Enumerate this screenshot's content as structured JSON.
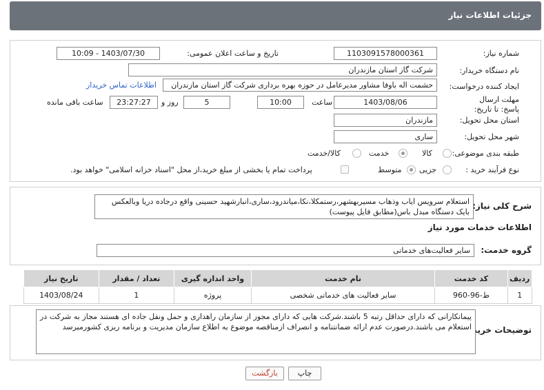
{
  "header": {
    "title": "جزئیات اطلاعات نیاز"
  },
  "form": {
    "need_number_label": "شماره نیاز:",
    "need_number": "1103091578000361",
    "announce_label": "تاریخ و ساعت اعلان عمومی:",
    "announce_value": "1403/07/30 - 10:09",
    "buyer_org_label": "نام دستگاه خریدار:",
    "buyer_org": "شرکت گاز استان مازندران",
    "creator_label": "ایجاد کننده درخواست:",
    "creator": "حشمت اله باوفا مشاور مدیرعامل در حوزه بهره برداری  شرکت گاز استان مازندران",
    "contact_link": "اطلاعات تماس خریدار",
    "deadline_label": "مهلت ارسال پاسخ: تا تاریخ:",
    "deadline_date": "1403/08/06",
    "time_label": "ساعت",
    "deadline_time": "10:00",
    "days_value": "5",
    "days_label": "روز و",
    "remaining_time": "23:27:27",
    "remaining_label": "ساعت باقی مانده",
    "province_label": "استان محل تحویل:",
    "province": "مازندران",
    "city_label": "شهر محل تحویل:",
    "city": "ساری",
    "category_label": "طبقه بندی موضوعی:",
    "category_options": [
      "کالا",
      "خدمت",
      "کالا/خدمت"
    ],
    "category_selected": "خدمت",
    "purchase_type_label": "نوع فرآیند خرید :",
    "purchase_options": [
      "جزیی",
      "متوسط"
    ],
    "purchase_selected": "متوسط",
    "payment_note": "پرداخت تمام یا بخشی از مبلغ خرید،از محل \"اسناد خزانه اسلامی\" خواهد بود."
  },
  "description": {
    "label": "شرح کلی نیاز:",
    "text": "استعلام سرویس ایاب وذهاب مسیربهشهر،رستمکلا،نکا،میاندرود،ساری،انبارشهید حسینی واقع درجاده دریا وبالعکس بایک دستگاه مبدل باس(مطابق فایل پیوست)"
  },
  "services": {
    "section_title": "اطلاعات خدمات مورد نیاز",
    "group_label": "گروه خدمت:",
    "group_value": "سایر فعالیت‌های خدماتی",
    "columns": [
      "ردیف",
      "کد خدمت",
      "نام خدمت",
      "واحد اندازه گیری",
      "تعداد / مقدار",
      "تاریخ نیاز"
    ],
    "rows": [
      {
        "row": "1",
        "code": "ط-96-960",
        "name": "سایر فعالیت های خدماتی شخصی",
        "unit": "پروژه",
        "qty": "1",
        "date": "1403/08/24"
      }
    ]
  },
  "buyer_notes": {
    "label": "توضیحات خریدار:",
    "text": "پیمانکارانی که دارای حداقل رتبه 5 باشند.شرکت هایی که دارای مجوز از سازمان راهداری و حمل ونقل جاده ای هستند مجاز به شرکت در استعلام می باشند.درصورت عدم ارائه ضمانتنامه و انصراف ازمناقصه موضوع به اطلاع سازمان مدیریت و برنامه ریزی کشورمیرسد"
  },
  "buttons": {
    "print": "چاپ",
    "back": "بازگشت"
  },
  "colors": {
    "header_bg": "#6c727a",
    "link": "#2a62c9",
    "table_header": "#d6d6d6"
  }
}
